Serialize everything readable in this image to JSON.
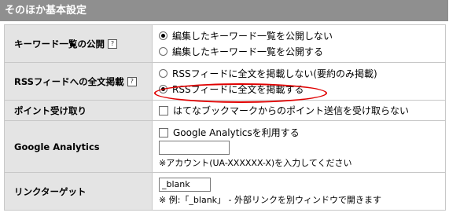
{
  "header": {
    "title": "そのほか基本設定"
  },
  "help_icon": "help-icon",
  "rows": {
    "keyword_public": {
      "label": "キーワード一覧の公開",
      "options": [
        "編集したキーワード一覧を公開しない",
        "編集したキーワード一覧を公開する"
      ],
      "selected": 0
    },
    "rss_full": {
      "label": "RSSフィードへの全文掲載",
      "options": [
        "RSSフィードに全文を掲載しない(要約のみ掲載)",
        "RSSフィードに全文を掲載する"
      ],
      "selected": 1,
      "highlight_color": "#e00000"
    },
    "points": {
      "label": "ポイント受け取り",
      "checkbox_label": "はてなブックマークからのポイント送信を受け取らない",
      "checked": false
    },
    "ga": {
      "label": "Google Analytics",
      "checkbox_label": "Google Analyticsを利用する",
      "checked": false,
      "input_value": "",
      "note": "※アカウント(UA-XXXXXX-X)を入力してください"
    },
    "link_target": {
      "label": "リンクターゲット",
      "input_value": "_blank",
      "note": "※ 例:「_blank」 - 外部リンクを別ウィンドウで開きます"
    }
  },
  "colors": {
    "header_bg": "#8f8f8f",
    "label_bg": "#e4e4e4",
    "border": "#c8c8c8",
    "highlight": "#e00000"
  }
}
